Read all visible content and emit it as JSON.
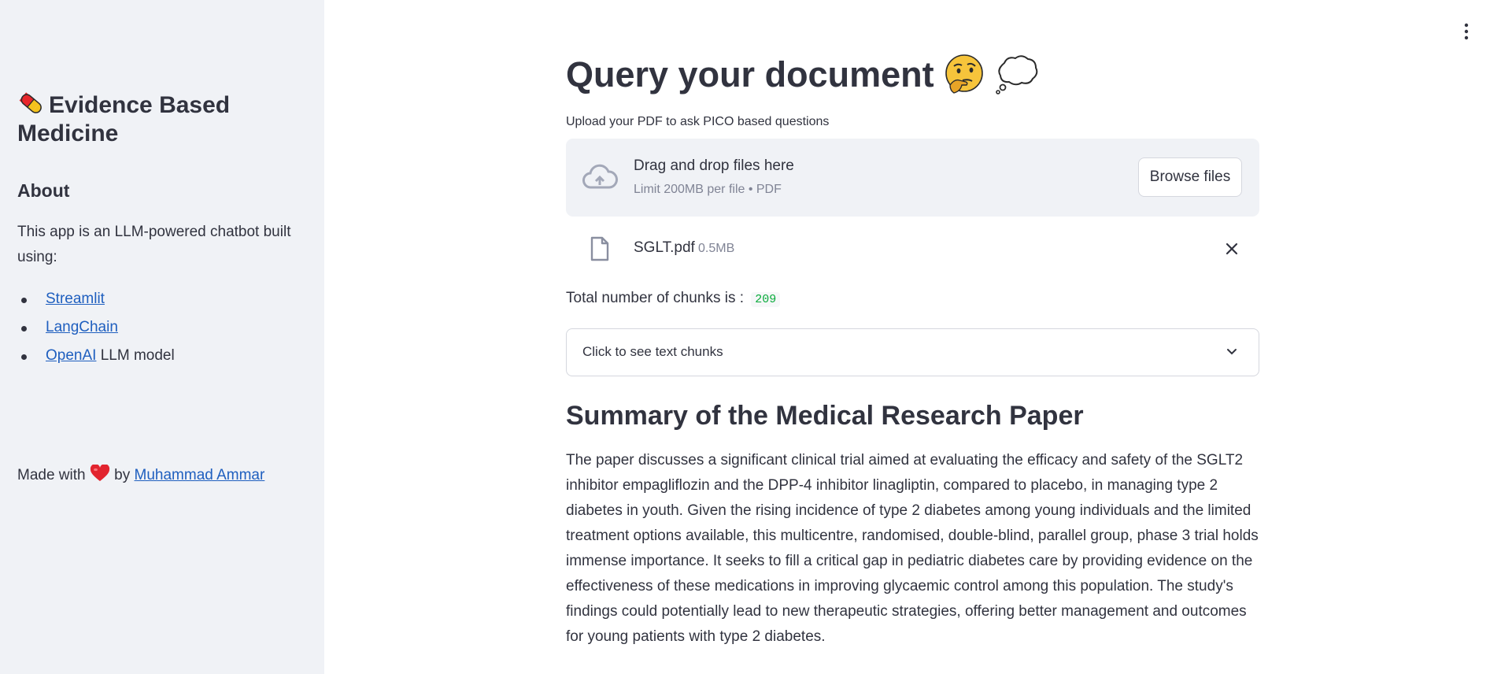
{
  "sidebar": {
    "app_title": "Evidence Based Medicine",
    "about_heading": "About",
    "about_text": "This app is an LLM-powered chatbot built using:",
    "links": [
      {
        "label": "Streamlit",
        "suffix": ""
      },
      {
        "label": "LangChain",
        "suffix": ""
      },
      {
        "label": "OpenAI",
        "suffix": " LLM model"
      }
    ],
    "made_with_prefix": "Made with",
    "made_with_by": "by",
    "author": "Muhammad Ammar"
  },
  "main": {
    "title": "Query your document",
    "uploader": {
      "label": "Upload your PDF to ask PICO based questions",
      "drop_text": "Drag and drop files here",
      "limit_text": "Limit 200MB per file • PDF",
      "browse_label": "Browse files"
    },
    "uploaded_file": {
      "name": "SGLT.pdf",
      "size": "0.5MB"
    },
    "chunks_label": "Total number of chunks is :",
    "chunks_count": "209",
    "expander_label": "Click to see text chunks",
    "summary_heading": "Summary of the Medical Research Paper",
    "summary_text": "The paper discusses a significant clinical trial aimed at evaluating the efficacy and safety of the SGLT2 inhibitor empagliflozin and the DPP-4 inhibitor linagliptin, compared to placebo, in managing type 2 diabetes in youth. Given the rising incidence of type 2 diabetes among young individuals and the limited treatment options available, this multicentre, randomised, double-blind, parallel group, phase 3 trial holds immense importance. It seeks to fill a critical gap in pediatric diabetes care by providing evidence on the effectiveness of these medications in improving glycaemic control among this population. The study's findings could potentially lead to new therapeutic strategies, offering better management and outcomes for young patients with type 2 diabetes."
  },
  "icons": {
    "title_prefix": "pill-icon",
    "title_suffix": [
      "thinking-face-icon",
      "thought-bubble-icon"
    ],
    "upload": "cloud-upload-icon",
    "file": "file-icon",
    "remove": "close-icon",
    "expand": "chevron-down-icon",
    "menu": "vertical-dots-menu-icon",
    "love": "heart-icon"
  },
  "colors": {
    "sidebar_bg": "#f0f2f6",
    "text": "#31333f",
    "link": "#1f5fbf",
    "chunk_count": "#09ab3b",
    "muted": "#808495"
  }
}
